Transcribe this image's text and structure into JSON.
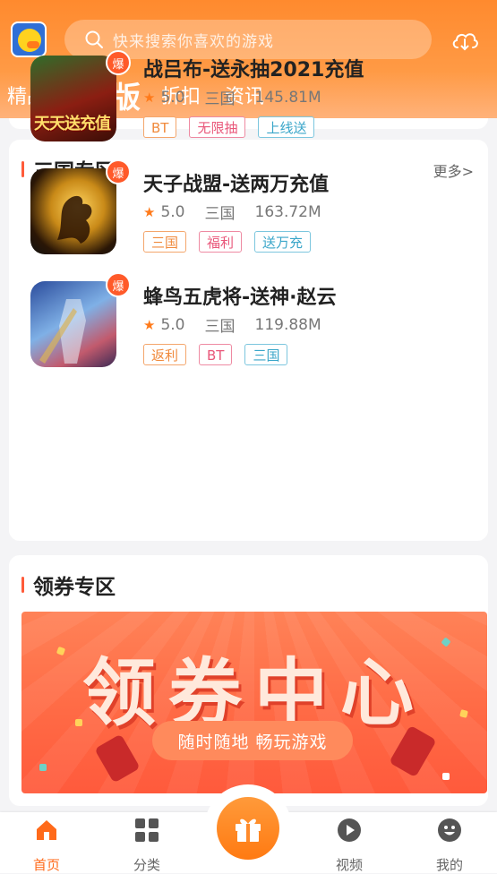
{
  "header": {
    "search_placeholder": "快来搜索你喜欢的游戏",
    "tabs": [
      "精品",
      "BT版",
      "折扣",
      "资讯"
    ],
    "active_tab": "BT版"
  },
  "sanguo": {
    "title": "三国专区",
    "more": "更多>",
    "games": [
      {
        "name": "战吕布-送永抽2021充值",
        "rating": "5.0",
        "genre": "三国",
        "size": "145.81M",
        "badge": "爆",
        "thumb_text": "天天送充值",
        "tags": [
          {
            "text": "BT",
            "color": "orange"
          },
          {
            "text": "无限抽",
            "color": "pink"
          },
          {
            "text": "上线送",
            "color": "teal"
          }
        ]
      },
      {
        "name": "天子战盟-送两万充值",
        "rating": "5.0",
        "genre": "三国",
        "size": "163.72M",
        "badge": "爆",
        "tags": [
          {
            "text": "三国",
            "color": "orange"
          },
          {
            "text": "福利",
            "color": "pink"
          },
          {
            "text": "送万充",
            "color": "teal"
          }
        ]
      },
      {
        "name": "蜂鸟五虎将-送神·赵云",
        "rating": "5.0",
        "genre": "三国",
        "size": "119.88M",
        "badge": "爆",
        "tags": [
          {
            "text": "返利",
            "color": "orange"
          },
          {
            "text": "BT",
            "color": "pink"
          },
          {
            "text": "三国",
            "color": "teal"
          }
        ]
      }
    ]
  },
  "coupon": {
    "title": "领券专区",
    "banner_title": "领券中心",
    "banner_subtitle": "随时随地 畅玩游戏"
  },
  "nav": {
    "home": "首页",
    "category": "分类",
    "video": "视频",
    "mine": "我的"
  },
  "colors": {
    "accent": "#ff7a1a",
    "tag_orange": "#f08a3c",
    "tag_pink": "#e9577a",
    "tag_teal": "#3aa6c9"
  }
}
